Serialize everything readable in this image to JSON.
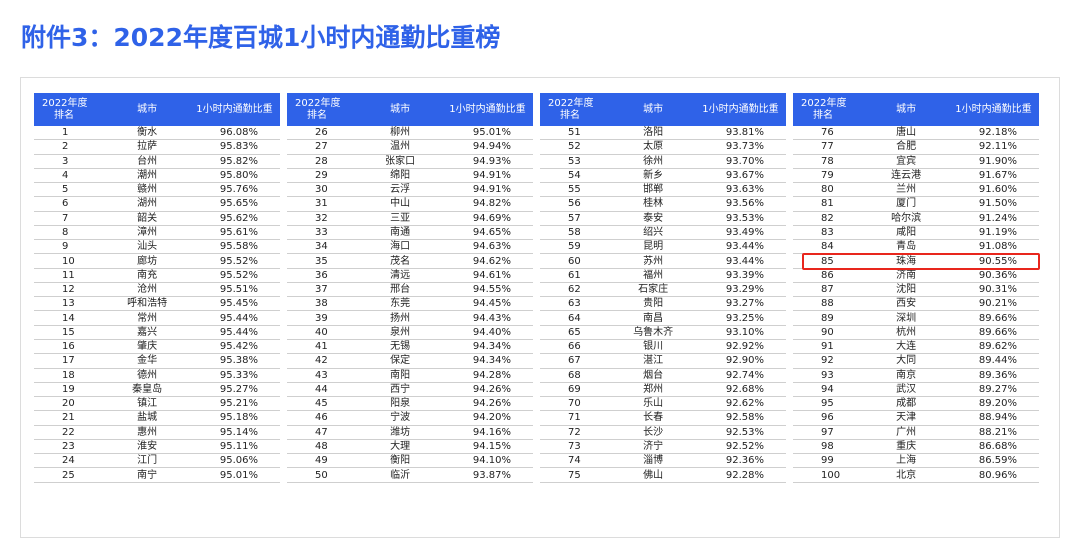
{
  "title": "附件3：2022年度百城1小时内通勤比重榜",
  "headers": {
    "rank_line1": "2022年度",
    "rank_line2": "排名",
    "city": "城市",
    "pct": "1小时内通勤比重"
  },
  "highlight_rank": 84,
  "highlight_color": "#e8261d",
  "accent_color": "#2f62e8",
  "panels": [
    [
      [
        "1",
        "衡水",
        "96.08%"
      ],
      [
        "2",
        "拉萨",
        "95.83%"
      ],
      [
        "3",
        "台州",
        "95.82%"
      ],
      [
        "4",
        "潮州",
        "95.80%"
      ],
      [
        "5",
        "赣州",
        "95.76%"
      ],
      [
        "6",
        "湖州",
        "95.65%"
      ],
      [
        "7",
        "韶关",
        "95.62%"
      ],
      [
        "8",
        "漳州",
        "95.61%"
      ],
      [
        "9",
        "汕头",
        "95.58%"
      ],
      [
        "10",
        "廊坊",
        "95.52%"
      ],
      [
        "11",
        "南充",
        "95.52%"
      ],
      [
        "12",
        "沧州",
        "95.51%"
      ],
      [
        "13",
        "呼和浩特",
        "95.45%"
      ],
      [
        "14",
        "常州",
        "95.44%"
      ],
      [
        "15",
        "嘉兴",
        "95.44%"
      ],
      [
        "16",
        "肇庆",
        "95.42%"
      ],
      [
        "17",
        "金华",
        "95.38%"
      ],
      [
        "18",
        "德州",
        "95.33%"
      ],
      [
        "19",
        "秦皇岛",
        "95.27%"
      ],
      [
        "20",
        "镇江",
        "95.21%"
      ],
      [
        "21",
        "盐城",
        "95.18%"
      ],
      [
        "22",
        "惠州",
        "95.14%"
      ],
      [
        "23",
        "淮安",
        "95.11%"
      ],
      [
        "24",
        "江门",
        "95.06%"
      ],
      [
        "25",
        "南宁",
        "95.01%"
      ]
    ],
    [
      [
        "26",
        "柳州",
        "95.01%"
      ],
      [
        "27",
        "温州",
        "94.94%"
      ],
      [
        "28",
        "张家口",
        "94.93%"
      ],
      [
        "29",
        "绵阳",
        "94.91%"
      ],
      [
        "30",
        "云浮",
        "94.91%"
      ],
      [
        "31",
        "中山",
        "94.82%"
      ],
      [
        "32",
        "三亚",
        "94.69%"
      ],
      [
        "33",
        "南通",
        "94.65%"
      ],
      [
        "34",
        "海口",
        "94.63%"
      ],
      [
        "35",
        "茂名",
        "94.62%"
      ],
      [
        "36",
        "清远",
        "94.61%"
      ],
      [
        "37",
        "邢台",
        "94.55%"
      ],
      [
        "38",
        "东莞",
        "94.45%"
      ],
      [
        "39",
        "扬州",
        "94.43%"
      ],
      [
        "40",
        "泉州",
        "94.40%"
      ],
      [
        "41",
        "无锡",
        "94.34%"
      ],
      [
        "42",
        "保定",
        "94.34%"
      ],
      [
        "43",
        "南阳",
        "94.28%"
      ],
      [
        "44",
        "西宁",
        "94.26%"
      ],
      [
        "45",
        "阳泉",
        "94.26%"
      ],
      [
        "46",
        "宁波",
        "94.20%"
      ],
      [
        "47",
        "潍坊",
        "94.16%"
      ],
      [
        "48",
        "大理",
        "94.15%"
      ],
      [
        "49",
        "衡阳",
        "94.10%"
      ],
      [
        "50",
        "临沂",
        "93.87%"
      ]
    ],
    [
      [
        "51",
        "洛阳",
        "93.81%"
      ],
      [
        "52",
        "太原",
        "93.73%"
      ],
      [
        "53",
        "徐州",
        "93.70%"
      ],
      [
        "54",
        "新乡",
        "93.67%"
      ],
      [
        "55",
        "邯郸",
        "93.63%"
      ],
      [
        "56",
        "桂林",
        "93.56%"
      ],
      [
        "57",
        "泰安",
        "93.53%"
      ],
      [
        "58",
        "绍兴",
        "93.49%"
      ],
      [
        "59",
        "昆明",
        "93.44%"
      ],
      [
        "60",
        "苏州",
        "93.44%"
      ],
      [
        "61",
        "福州",
        "93.39%"
      ],
      [
        "62",
        "石家庄",
        "93.29%"
      ],
      [
        "63",
        "贵阳",
        "93.27%"
      ],
      [
        "64",
        "南昌",
        "93.25%"
      ],
      [
        "65",
        "乌鲁木齐",
        "93.10%"
      ],
      [
        "66",
        "银川",
        "92.92%"
      ],
      [
        "67",
        "湛江",
        "92.90%"
      ],
      [
        "68",
        "烟台",
        "92.74%"
      ],
      [
        "69",
        "郑州",
        "92.68%"
      ],
      [
        "70",
        "乐山",
        "92.62%"
      ],
      [
        "71",
        "长春",
        "92.58%"
      ],
      [
        "72",
        "长沙",
        "92.53%"
      ],
      [
        "73",
        "济宁",
        "92.52%"
      ],
      [
        "74",
        "淄博",
        "92.36%"
      ],
      [
        "75",
        "佛山",
        "92.28%"
      ]
    ],
    [
      [
        "76",
        "唐山",
        "92.18%"
      ],
      [
        "77",
        "合肥",
        "92.11%"
      ],
      [
        "78",
        "宜宾",
        "91.90%"
      ],
      [
        "79",
        "连云港",
        "91.67%"
      ],
      [
        "80",
        "兰州",
        "91.60%"
      ],
      [
        "81",
        "厦门",
        "91.50%"
      ],
      [
        "82",
        "哈尔滨",
        "91.24%"
      ],
      [
        "83",
        "咸阳",
        "91.19%"
      ],
      [
        "84",
        "青岛",
        "91.08%"
      ],
      [
        "85",
        "珠海",
        "90.55%"
      ],
      [
        "86",
        "济南",
        "90.36%"
      ],
      [
        "87",
        "沈阳",
        "90.31%"
      ],
      [
        "88",
        "西安",
        "90.21%"
      ],
      [
        "89",
        "深圳",
        "89.66%"
      ],
      [
        "90",
        "杭州",
        "89.66%"
      ],
      [
        "91",
        "大连",
        "89.62%"
      ],
      [
        "92",
        "大同",
        "89.44%"
      ],
      [
        "93",
        "南京",
        "89.36%"
      ],
      [
        "94",
        "武汉",
        "89.27%"
      ],
      [
        "95",
        "成都",
        "89.20%"
      ],
      [
        "96",
        "天津",
        "88.94%"
      ],
      [
        "97",
        "广州",
        "88.21%"
      ],
      [
        "98",
        "重庆",
        "86.68%"
      ],
      [
        "99",
        "上海",
        "86.59%"
      ],
      [
        "100",
        "北京",
        "80.96%"
      ]
    ]
  ]
}
